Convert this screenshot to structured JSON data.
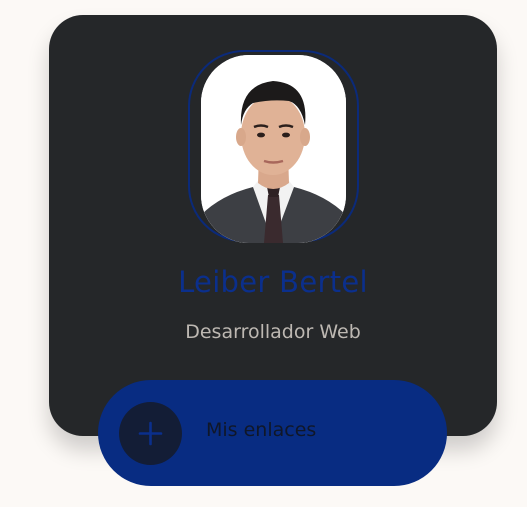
{
  "profile": {
    "name": "Leiber Bertel",
    "role": "Desarrollador Web",
    "avatar_icon": "profile-photo"
  },
  "links_button": {
    "label": "Mis enlaces",
    "icon": "plus-icon"
  },
  "colors": {
    "page_background": "#fcf9f6",
    "card_background": "#252729",
    "accent_blue": "#082c82",
    "name_text": "#0b2f8c",
    "role_text": "#bdb8b2"
  }
}
